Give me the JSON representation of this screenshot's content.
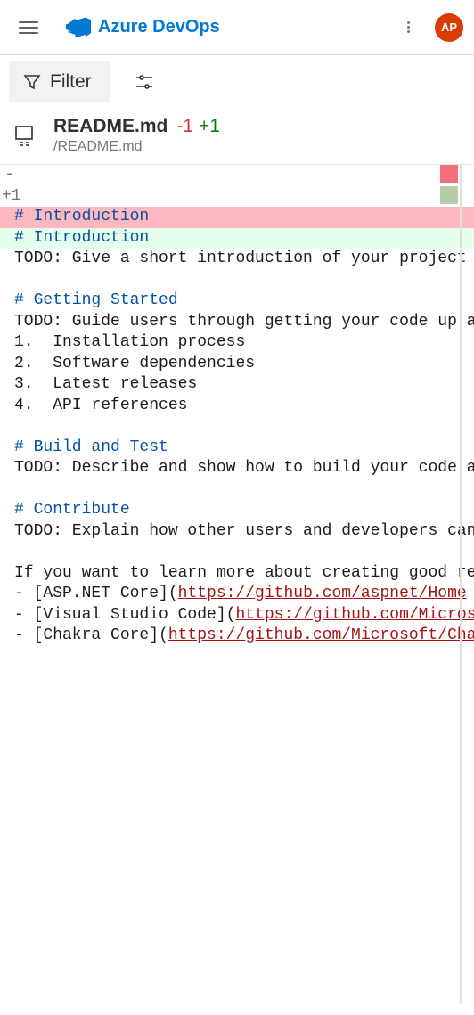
{
  "header": {
    "brand": "Azure DevOps",
    "avatar_initials": "AP"
  },
  "toolbar": {
    "filter_label": "Filter"
  },
  "file": {
    "name": "README.md",
    "diff_minus": "-1",
    "diff_plus": "+1",
    "path": "/README.md"
  },
  "diff": {
    "removed_prefix": "-",
    "added_prefix": "+1",
    "lines": [
      {
        "type": "removed",
        "text": "# Introduction",
        "is_heading": true
      },
      {
        "type": "added",
        "text": "# Introduction",
        "is_heading": true
      },
      {
        "type": "ctx",
        "text": "TODO: Give a short introduction of your project"
      },
      {
        "type": "blank"
      },
      {
        "type": "heading",
        "text": "# Getting Started"
      },
      {
        "type": "ctx",
        "text": "TODO: Guide users through getting your code up a"
      },
      {
        "type": "ctx",
        "text": "1.  Installation process"
      },
      {
        "type": "ctx",
        "text": "2.  Software dependencies"
      },
      {
        "type": "ctx",
        "text": "3.  Latest releases"
      },
      {
        "type": "ctx",
        "text": "4.  API references"
      },
      {
        "type": "blank"
      },
      {
        "type": "heading",
        "text": "# Build and Test"
      },
      {
        "type": "ctx",
        "text": "TODO: Describe and show how to build your code a"
      },
      {
        "type": "blank"
      },
      {
        "type": "heading",
        "text": "# Contribute"
      },
      {
        "type": "ctx",
        "text": "TODO: Explain how other users and developers can"
      },
      {
        "type": "blank"
      },
      {
        "type": "ctx",
        "text": "If you want to learn more about creating good re"
      },
      {
        "type": "link",
        "pre": "- [ASP.NET Core](",
        "url": "https://github.com/aspnet/Home"
      },
      {
        "type": "link",
        "pre": "- [Visual Studio Code](",
        "url": "https://github.com/Micros"
      },
      {
        "type": "link",
        "pre": "- [Chakra Core](",
        "url": "https://github.com/Microsoft/Cha"
      }
    ]
  }
}
